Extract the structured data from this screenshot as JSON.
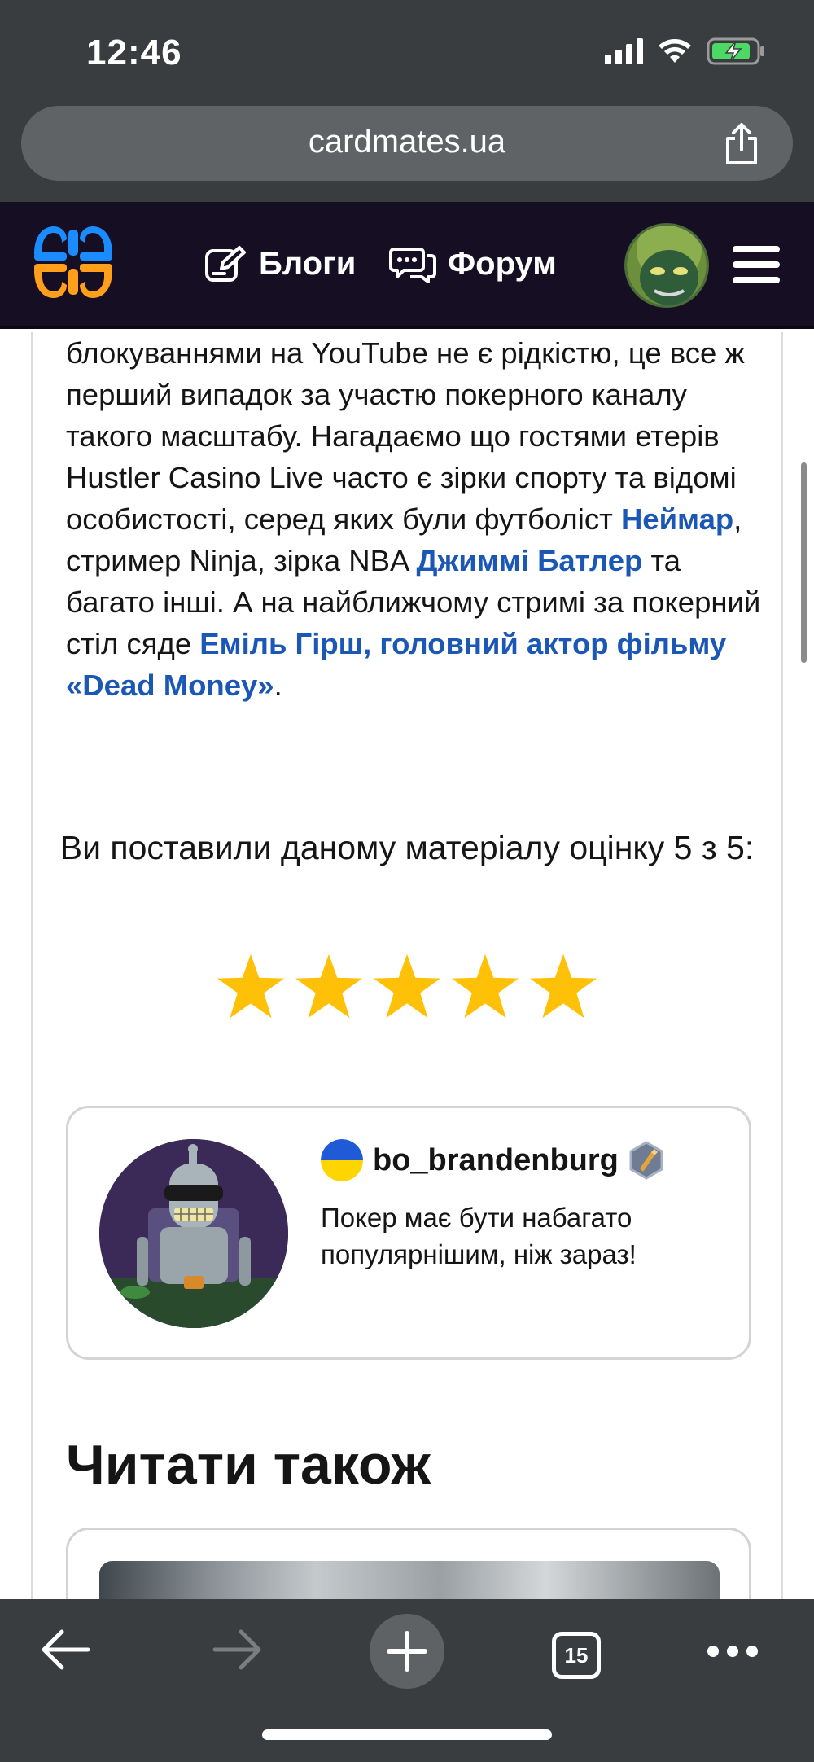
{
  "status_bar": {
    "time": "12:46"
  },
  "browser": {
    "url": "cardmates.ua",
    "tab_count": "15"
  },
  "header": {
    "nav": [
      {
        "label": "Блоги",
        "icon": "edit-icon"
      },
      {
        "label": "Форум",
        "icon": "chat-icon"
      }
    ]
  },
  "article": {
    "p1": "блокуваннями на YouTube не є рідкістю, це все ж перший випадок за участю покерного каналу такого масштабу. Нагадаємо що гостями етерів Hustler Casino Live часто є зірки спорту та відомі особистості, серед яких були футболіст ",
    "link_neymar": "Неймар",
    "p2": ", стример Ninja, зірка NBA ",
    "link_butler": "Джиммі Батлер",
    "p3": " та багато інші. А на найближчому стримі за покерний стіл сяде ",
    "link_hirsch": "Еміль Гірш, головний актор фільму «Dead Money»",
    "p4": "."
  },
  "rating": {
    "label": "Ви поставили даному матеріалу оцінку 5 з 5:",
    "value": 5,
    "max": 5,
    "star_color": "#ffc107"
  },
  "comment": {
    "username": "bo_brandenburg",
    "text": "Покер має бути набагато популярнішим, ніж зараз!",
    "flag": "ukraine-flag"
  },
  "read_also": {
    "title": "Читати також"
  },
  "colors": {
    "header_bg": "#160f24",
    "link": "#1b57b5",
    "logo_blue": "#1a8cff",
    "logo_orange": "#ff9f1a"
  }
}
